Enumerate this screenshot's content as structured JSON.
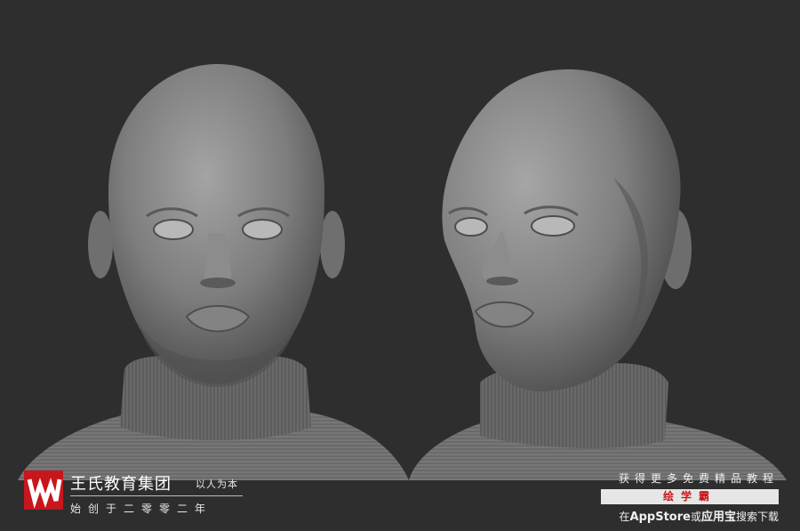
{
  "image": {
    "description_colors": {
      "background": "#2e2e2e",
      "skin": "#8a8a8a",
      "sweater": "#6a6a6a",
      "accent": "#c8161d"
    }
  },
  "brand": {
    "name": "王氏教育集团",
    "slogan": "以人为本",
    "founded": "始创于二零零二年",
    "logo_color": "#c8161d"
  },
  "promo": {
    "line1": "获得更多免费精品教程",
    "banner": "绘学霸",
    "line3_prefix": "在",
    "line3_store1": "AppStore",
    "line3_mid": "或",
    "line3_store2": "应用宝",
    "line3_suffix": "搜索下载"
  }
}
